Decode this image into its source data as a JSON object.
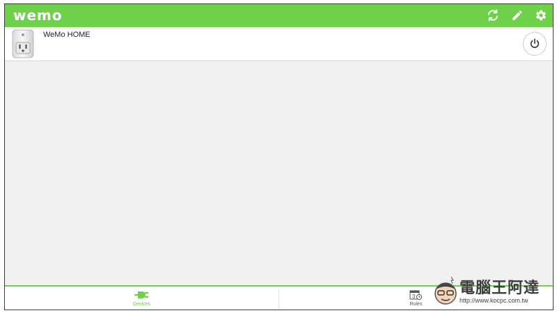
{
  "app": {
    "logo": "wemo",
    "accent_color": "#6fd14a",
    "header_icons": [
      "refresh-icon",
      "edit-icon",
      "settings-icon"
    ]
  },
  "devices": [
    {
      "name": "WeMo HOME",
      "icon": "wemo-switch-plug",
      "action_icon": "power-icon"
    }
  ],
  "tabs": [
    {
      "label": "Devices",
      "icon": "plug-icon",
      "active": true
    },
    {
      "label": "Rules",
      "icon": "calendar-clock-icon",
      "active": false
    }
  ],
  "watermark": {
    "title": "電腦王阿達",
    "url": "http://www.kocpc.com.tw"
  }
}
